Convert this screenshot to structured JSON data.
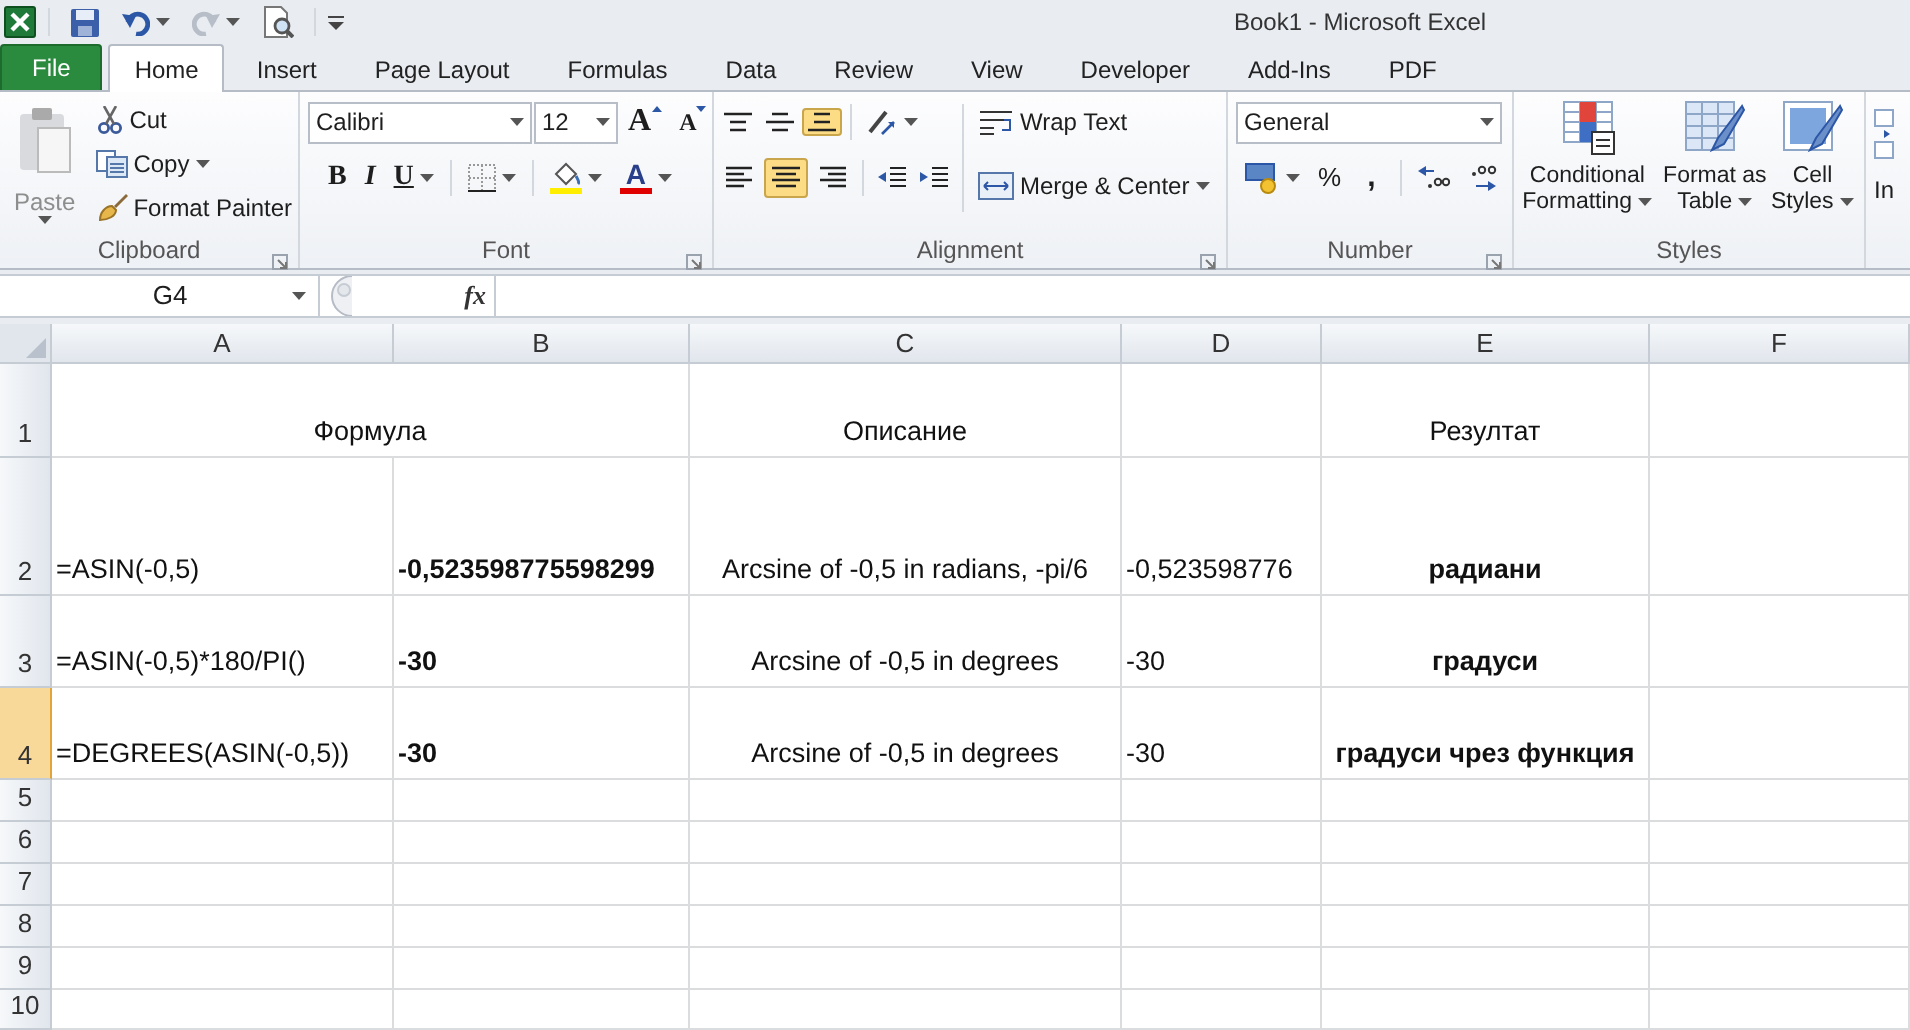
{
  "window": {
    "title": "Book1  -  Microsoft Excel"
  },
  "tabs": [
    {
      "label": "File",
      "kind": "file",
      "selected": false
    },
    {
      "label": "Home",
      "kind": "tab",
      "selected": true
    },
    {
      "label": "Insert",
      "kind": "tab",
      "selected": false
    },
    {
      "label": "Page Layout",
      "kind": "tab",
      "selected": false
    },
    {
      "label": "Formulas",
      "kind": "tab",
      "selected": false
    },
    {
      "label": "Data",
      "kind": "tab",
      "selected": false
    },
    {
      "label": "Review",
      "kind": "tab",
      "selected": false
    },
    {
      "label": "View",
      "kind": "tab",
      "selected": false
    },
    {
      "label": "Developer",
      "kind": "tab",
      "selected": false
    },
    {
      "label": "Add-Ins",
      "kind": "tab",
      "selected": false
    },
    {
      "label": "PDF",
      "kind": "tab",
      "selected": false
    }
  ],
  "ribbon": {
    "clipboard": {
      "label": "Clipboard",
      "paste": {
        "label": "Paste",
        "disabled": true
      },
      "cut": "Cut",
      "copy": "Copy",
      "format_painter": "Format Painter"
    },
    "font": {
      "label": "Font",
      "name": "Calibri",
      "size": "12",
      "grow": "A",
      "shrink": "A",
      "bold": "B",
      "italic": "I",
      "underline": "U",
      "font_color": "A"
    },
    "alignment": {
      "label": "Alignment",
      "vertical": [
        {
          "selected": false
        },
        {
          "selected": false
        },
        {
          "selected": true
        }
      ],
      "horizontal": [
        {
          "selected": false
        },
        {
          "selected": true
        },
        {
          "selected": false
        }
      ],
      "wrap_text": "Wrap Text",
      "merge": "Merge & Center"
    },
    "number": {
      "label": "Number",
      "format": "General",
      "percent": "%",
      "comma": ","
    },
    "styles": {
      "label": "Styles",
      "buttons": [
        "Conditional Formatting",
        "Format as Table",
        "Cell Styles"
      ]
    },
    "next_group_partial": "In"
  },
  "formula_bar": {
    "name_box": "G4",
    "function_button": "fx"
  },
  "sheet": {
    "columns": [
      "A",
      "B",
      "C",
      "D",
      "E",
      "F"
    ],
    "rows": [
      {
        "label": "1",
        "selected": false,
        "cells": [
          {
            "text": "Формула"
          },
          {
            "text": ""
          },
          {
            "text": "Описание"
          },
          {
            "text": ""
          },
          {
            "text": "Резултат"
          },
          {
            "text": ""
          }
        ]
      },
      {
        "label": "2",
        "selected": false,
        "cells": [
          {
            "text": "=ASIN(-0,5)"
          },
          {
            "text": "-0,523598775598299",
            "bold": true
          },
          {
            "text": "Arcsine of -0,5 in radians, -pi/6"
          },
          {
            "text": "-0,523598776"
          },
          {
            "text": "радиани",
            "bold": true
          },
          {
            "text": ""
          }
        ]
      },
      {
        "label": "3",
        "selected": false,
        "cells": [
          {
            "text": "=ASIN(-0,5)*180/PI()"
          },
          {
            "text": "-30",
            "bold": true
          },
          {
            "text": "Arcsine of -0,5 in degrees"
          },
          {
            "text": "-30"
          },
          {
            "text": "градуси",
            "bold": true
          },
          {
            "text": ""
          }
        ]
      },
      {
        "label": "4",
        "selected": true,
        "cells": [
          {
            "text": "=DEGREES(ASIN(-0,5))"
          },
          {
            "text": "-30",
            "bold": true
          },
          {
            "text": "Arcsine of -0,5 in degrees"
          },
          {
            "text": "-30"
          },
          {
            "text": "градуси чрез функция",
            "bold": true
          },
          {
            "text": ""
          }
        ]
      },
      {
        "label": "5",
        "selected": false,
        "cells": []
      },
      {
        "label": "6",
        "selected": false,
        "cells": []
      },
      {
        "label": "7",
        "selected": false,
        "cells": []
      },
      {
        "label": "8",
        "selected": false,
        "cells": []
      },
      {
        "label": "9",
        "selected": false,
        "cells": []
      },
      {
        "label": "10",
        "selected": false,
        "cells": []
      }
    ]
  }
}
